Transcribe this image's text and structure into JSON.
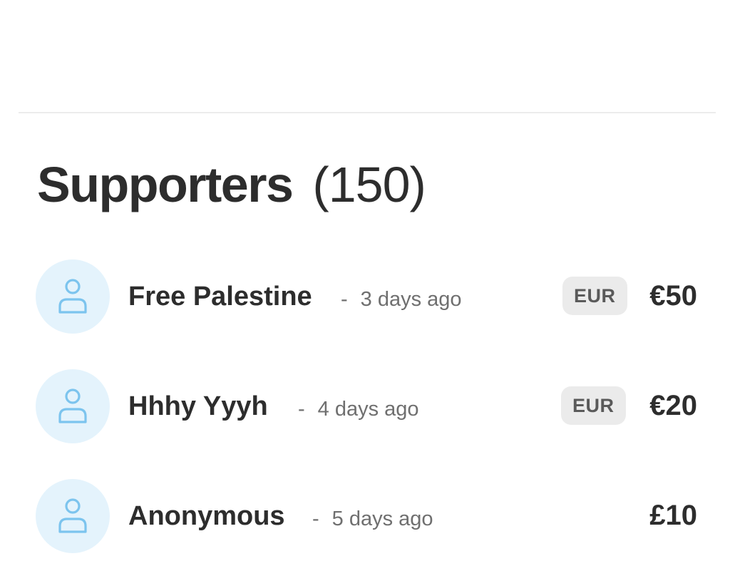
{
  "supporters": {
    "title": "Supporters",
    "count": "(150)",
    "items": [
      {
        "name": "Free Palestine",
        "separator": "-",
        "time": "3 days ago",
        "currency": "EUR",
        "amount": "€50",
        "avatar_icon": "user-icon"
      },
      {
        "name": "Hhhy Yyyh",
        "separator": "-",
        "time": "4 days ago",
        "currency": "EUR",
        "amount": "€20",
        "avatar_icon": "user-icon"
      },
      {
        "name": "Anonymous",
        "separator": "-",
        "time": "5 days ago",
        "amount": "£10",
        "avatar_icon": "user-icon"
      }
    ]
  },
  "colors": {
    "avatar_bg": "#e4f3fc",
    "avatar_icon": "#7cc4ee",
    "badge_bg": "#ebebeb",
    "text_primary": "#2d2d2d",
    "text_secondary": "#6f6f6f"
  }
}
